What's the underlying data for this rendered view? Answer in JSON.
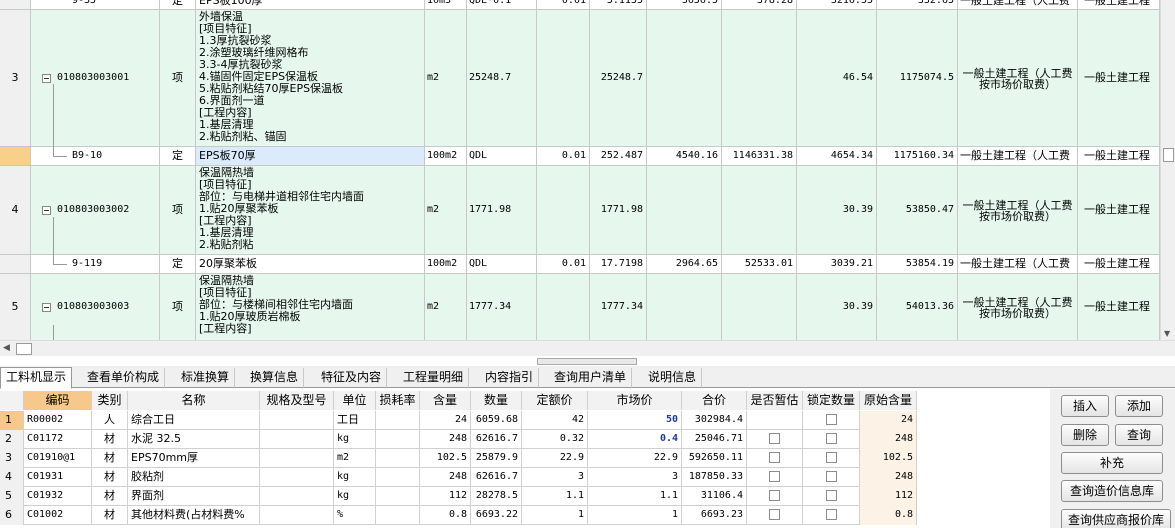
{
  "upper_rows": [
    {
      "type": "partial_top",
      "code": "9-35",
      "cat": "定",
      "name": "EPS板100厚",
      "unit": "10m3",
      "expr": "QDL*0.1",
      "qty_factor": "0.01",
      "qty": "5.1155",
      "unit_price": "3656.5",
      "total_price": "378.28",
      "comp_unit_price": "3216.55",
      "comp_total_price": "332.65",
      "profession": "一般土建工程（人工费",
      "profession2": "一般土建工程"
    },
    {
      "type": "qd",
      "idx": "3",
      "code": "010803003001",
      "cat": "项",
      "name_lines": [
        "外墙保温",
        "[项目特征]",
        "1.3厚抗裂砂浆",
        "2.涂塑玻璃纤维网格布",
        "3.3-4厚抗裂砂浆",
        "4.锚固件固定EPS保温板",
        "5.粘贴剂粘结70厚EPS保温板",
        "6.界面剂一道",
        "[工程内容]",
        "1.基层清理",
        "2.粘贴剂粘、锚固"
      ],
      "unit": "m2",
      "expr": "25248.7",
      "qty_factor": "",
      "qty": "25248.7",
      "unit_price": "",
      "total_price": "",
      "comp_unit_price": "46.54",
      "comp_total_price": "1175074.5",
      "profession": "一般土建工程（人工费按市场价取费）",
      "profession2": "一般土建工程"
    },
    {
      "type": "de",
      "idx": "",
      "code": "B9-10",
      "cat": "定",
      "name": "EPS板70厚",
      "unit": "100m2",
      "expr": "QDL",
      "qty_factor": "0.01",
      "qty": "252.487",
      "unit_price": "4540.16",
      "total_price": "1146331.38",
      "comp_unit_price": "4654.34",
      "comp_total_price": "1175160.34",
      "profession": "一般土建工程（人工费",
      "profession2": "一般土建工程"
    },
    {
      "type": "qd",
      "idx": "4",
      "code": "010803003002",
      "cat": "项",
      "name_lines": [
        "保温隔热墙",
        "[项目特征]",
        "部位：与电梯井道相邻住宅内墙面",
        "1.贴20厚聚苯板",
        "[工程内容]",
        "1.基层清理",
        "2.粘贴剂粘"
      ],
      "unit": "m2",
      "expr": "1771.98",
      "qty_factor": "",
      "qty": "1771.98",
      "unit_price": "",
      "total_price": "",
      "comp_unit_price": "30.39",
      "comp_total_price": "53850.47",
      "profession": "一般土建工程（人工费按市场价取费）",
      "profession2": "一般土建工程"
    },
    {
      "type": "de",
      "idx": "",
      "code": "9-119",
      "cat": "定",
      "name": "20厚聚苯板",
      "unit": "100m2",
      "expr": "QDL",
      "qty_factor": "0.01",
      "qty": "17.7198",
      "unit_price": "2964.65",
      "total_price": "52533.01",
      "comp_unit_price": "3039.21",
      "comp_total_price": "53854.19",
      "profession": "一般土建工程（人工费",
      "profession2": "一般土建工程"
    },
    {
      "type": "qd",
      "idx": "5",
      "code": "010803003003",
      "cat": "项",
      "name_lines": [
        "保温隔热墙",
        "[项目特征]",
        "部位：与楼梯间相邻住宅内墙面",
        "1.贴20厚玻质岩棉板",
        "[工程内容]"
      ],
      "unit": "m2",
      "expr": "1777.34",
      "qty_factor": "",
      "qty": "1777.34",
      "unit_price": "",
      "total_price": "",
      "comp_unit_price": "30.39",
      "comp_total_price": "54013.36",
      "profession": "一般土建工程（人工费按市场价取费）",
      "profession2": "一般土建工程"
    }
  ],
  "tabs": [
    "工料机显示",
    "查看单价构成",
    "标准换算",
    "换算信息",
    "特征及内容",
    "工程量明细",
    "内容指引",
    "查询用户清单",
    "说明信息"
  ],
  "lower_headers": {
    "code": "编码",
    "type": "类别",
    "name": "名称",
    "spec": "规格及型号",
    "unit": "单位",
    "loss": "损耗率",
    "qty": "含量",
    "num": "数量",
    "quota_price": "定额价",
    "market_price": "市场价",
    "amount": "合价",
    "is_estimate": "是否暂估",
    "lock_qty": "锁定数量",
    "orig_qty": "原始含量"
  },
  "lower_rows": [
    {
      "idx": "1",
      "code": "R00002",
      "type": "人",
      "name": "综合工日",
      "spec": "",
      "unit": "工日",
      "loss": "",
      "qty": "24",
      "num": "6059.68",
      "quota_price": "42",
      "market_price": "50",
      "amount": "302984.4",
      "has_check": false,
      "orig_qty": "24",
      "mp_blue": true
    },
    {
      "idx": "2",
      "code": "C01172",
      "type": "材",
      "name": "水泥 32.5",
      "spec": "",
      "unit": "kg",
      "loss": "",
      "qty": "248",
      "num": "62616.7",
      "quota_price": "0.32",
      "market_price": "0.4",
      "amount": "25046.71",
      "has_check": true,
      "orig_qty": "248",
      "mp_blue": true
    },
    {
      "idx": "3",
      "code": "C01910@1",
      "type": "材",
      "name": "EPS70mm厚",
      "spec": "",
      "unit": "m2",
      "loss": "",
      "qty": "102.5",
      "num": "25879.9",
      "quota_price": "22.9",
      "market_price": "22.9",
      "amount": "592650.11",
      "has_check": true,
      "orig_qty": "102.5",
      "mp_blue": false
    },
    {
      "idx": "4",
      "code": "C01931",
      "type": "材",
      "name": "胶粘剂",
      "spec": "",
      "unit": "kg",
      "loss": "",
      "qty": "248",
      "num": "62616.7",
      "quota_price": "3",
      "market_price": "3",
      "amount": "187850.33",
      "has_check": true,
      "orig_qty": "248",
      "mp_blue": false
    },
    {
      "idx": "5",
      "code": "C01932",
      "type": "材",
      "name": "界面剂",
      "spec": "",
      "unit": "kg",
      "loss": "",
      "qty": "112",
      "num": "28278.5",
      "quota_price": "1.1",
      "market_price": "1.1",
      "amount": "31106.4",
      "has_check": true,
      "orig_qty": "112",
      "mp_blue": false
    },
    {
      "idx": "6",
      "code": "C01002",
      "type": "材",
      "name": "其他材料费(占材料费%",
      "spec": "",
      "unit": "%",
      "loss": "",
      "qty": "0.8",
      "num": "6693.22",
      "quota_price": "1",
      "market_price": "1",
      "amount": "6693.23",
      "has_check": true,
      "orig_qty": "0.8",
      "mp_blue": false
    }
  ],
  "buttons": {
    "insert": "插入",
    "add": "添加",
    "delete": "删除",
    "query": "查询",
    "supplement": "补充",
    "query_cost_db": "查询造价信息库",
    "query_supplier_db": "查询供应商报价库"
  },
  "colors": {
    "qd_row_bg": "#e6f8ee",
    "selected_row_idx": "#f8d08a",
    "header_highlight": "#f6c98a",
    "market_price_blue": "#1a3aa8"
  }
}
